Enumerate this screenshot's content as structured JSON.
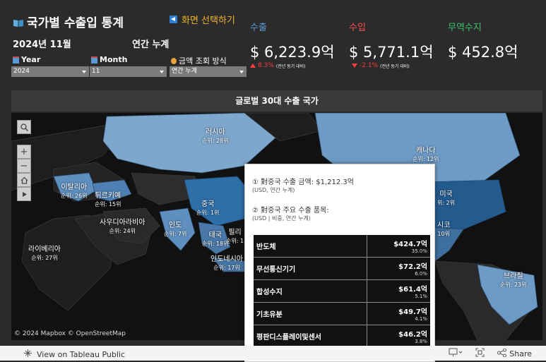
{
  "header": {
    "title": "국가별 수출입 통계",
    "screen_select": "화면 선택하기",
    "period": "2024년 11월",
    "cumulative": "연간 누계"
  },
  "filters": {
    "year_label": "Year",
    "year_value": "2024",
    "month_label": "Month",
    "month_value": "11",
    "method_label": "금액 조회 방식",
    "method_value": "연간 누계"
  },
  "kpis": {
    "export": {
      "label": "수출",
      "value": "$ 6,223.9억",
      "change": "8.3%",
      "note": "(전년 동기 대비)",
      "color": "#5b9bd5"
    },
    "import": {
      "label": "수입",
      "value": "$ 5,771.1억",
      "change": "-2.1%",
      "note": "(전년 동기 대비)",
      "color": "#ff4d4d"
    },
    "balance": {
      "label": "무역수지",
      "value": "$ 452.8억",
      "color": "#39c16c"
    }
  },
  "map": {
    "header": "글로벌 30대 수출 국가",
    "attribution": "© 2024 Mapbox © OpenStreetMap",
    "countries": [
      {
        "name": "러시아",
        "rank": "순위: 28위"
      },
      {
        "name": "캐나다",
        "rank": "순위: 12위"
      },
      {
        "name": "이탈리아",
        "rank": "순위: 26위"
      },
      {
        "name": "튀르키예",
        "rank": "순위: 15위"
      },
      {
        "name": "사우디아라비아",
        "rank": "순위: 24위"
      },
      {
        "name": "중국",
        "rank": "순위: 1위"
      },
      {
        "name": "인도",
        "rank": "순위: 7위"
      },
      {
        "name": "태국",
        "rank": "순위: 18위"
      },
      {
        "name": "필리",
        "rank": "순위: 1"
      },
      {
        "name": "인도네시아",
        "rank": "순위: 17위"
      },
      {
        "name": "라이베리아",
        "rank": "순위: 27위"
      },
      {
        "name": "미국",
        "rank": "위: 2위"
      },
      {
        "name": "시코",
        "rank": "10위"
      },
      {
        "name": "브라질",
        "rank": "순위: 23위"
      }
    ]
  },
  "tooltip": {
    "line1": "① 對중국 수출 금액: $1,212.3억",
    "line1_sub": "(USD,  연간 누계)",
    "line2": "② 對중국 주요 수출 품목:",
    "line2_sub": "(USD | 비중,  연간 누계)",
    "items": [
      {
        "name": "반도체",
        "value": "$424.7억",
        "pct": "35.0%"
      },
      {
        "name": "무선통신기기",
        "value": "$72.2억",
        "pct": "6.0%"
      },
      {
        "name": "합성수지",
        "value": "$61.4억",
        "pct": "5.1%"
      },
      {
        "name": "기초유분",
        "value": "$49.7억",
        "pct": "4.1%"
      },
      {
        "name": "평판디스플레이및센서",
        "value": "$46.2억",
        "pct": "3.8%"
      }
    ]
  },
  "footer": {
    "view_link": "View on Tableau Public",
    "share": "Share"
  }
}
